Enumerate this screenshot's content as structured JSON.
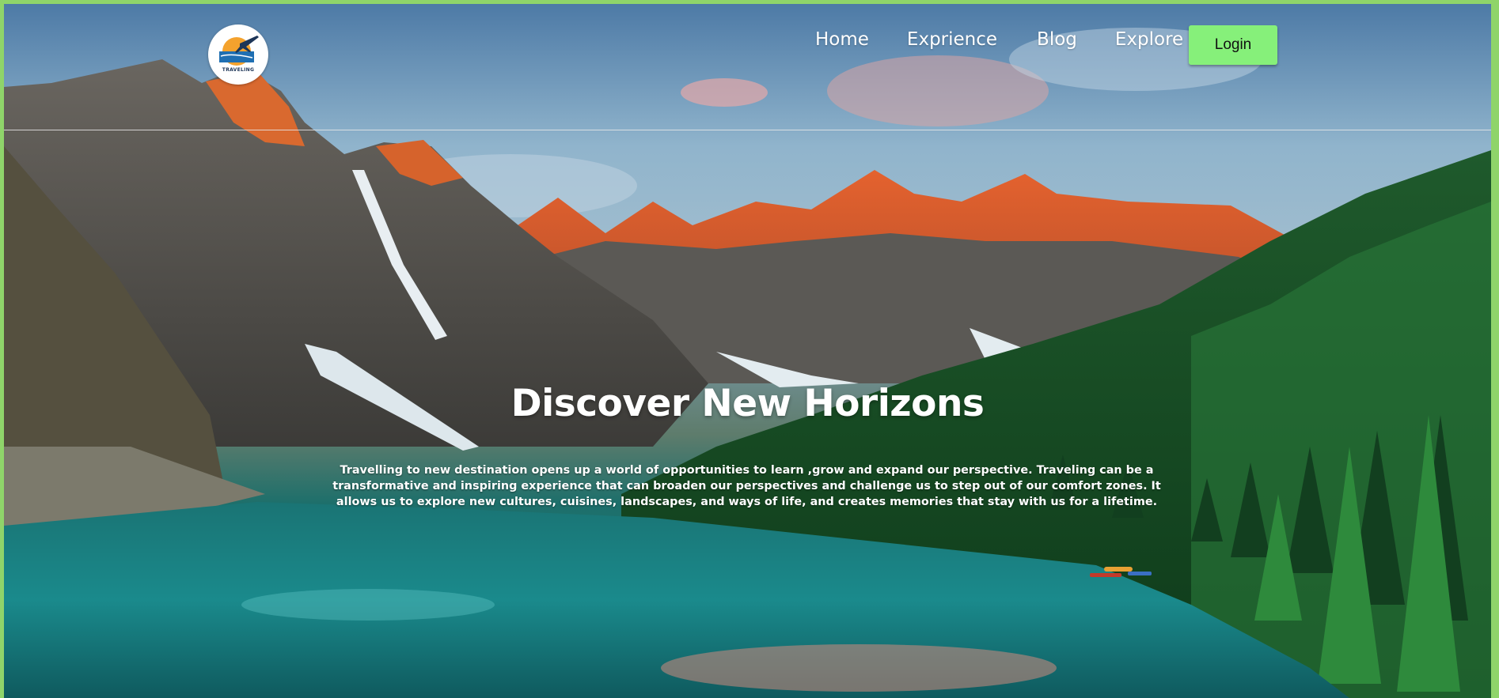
{
  "logo": {
    "text": "TRAVELING",
    "icon": "airplane-sunset-logo"
  },
  "nav": {
    "links": [
      "Home",
      "Exprience",
      "Blog",
      "Explore"
    ],
    "login_label": "Login"
  },
  "hero": {
    "title": "Discover New Horizons",
    "text": "Travelling to new destination opens up a world of opportunities to learn ,grow and expand our perspective. Traveling can be a transformative and inspiring experience that can broaden our perspectives and challenge us to step out of our comfort zones. It allows us to explore new cultures, cuisines, landscapes, and ways of life, and creates memories that stay with us for a lifetime."
  },
  "colors": {
    "page_border": "#8fd46a",
    "login_button": "#86f07a",
    "text": "#ffffff"
  }
}
